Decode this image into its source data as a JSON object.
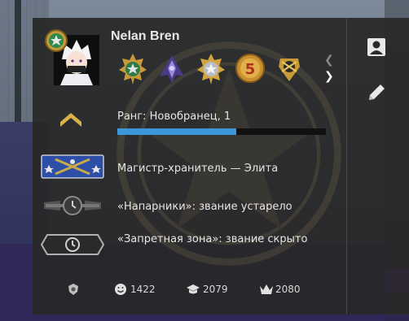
{
  "profile": {
    "username": "Nelan Bren",
    "rank_label": "Ранг: Новобранец, 1",
    "rank_progress": 0.57
  },
  "medals": [
    {
      "name": "service-medal-green-star-icon"
    },
    {
      "name": "operation-coin-purple-icon"
    },
    {
      "name": "service-medal-silver-star-icon"
    },
    {
      "name": "five-year-coin-icon"
    },
    {
      "name": "loyalty-badge-gold-icon"
    }
  ],
  "competitive": {
    "text": "Магистр-хранитель — Элита"
  },
  "wingman": {
    "text": "«Напарники»: звание устарело"
  },
  "danger_zone": {
    "text": "«Запретная зона»: звание скрыто"
  },
  "stats": {
    "friendly": "1422",
    "teacher": "2079",
    "leader": "2080"
  },
  "icons": {
    "side_profile": "profile-card-icon",
    "side_edit": "pencil-edit-icon",
    "nav_prev": "chevron-left-icon",
    "nav_next": "chevron-right-icon"
  },
  "colors": {
    "progress": "#3b97d8",
    "panel_bg": "#282828",
    "gold": "#d9b24a"
  }
}
